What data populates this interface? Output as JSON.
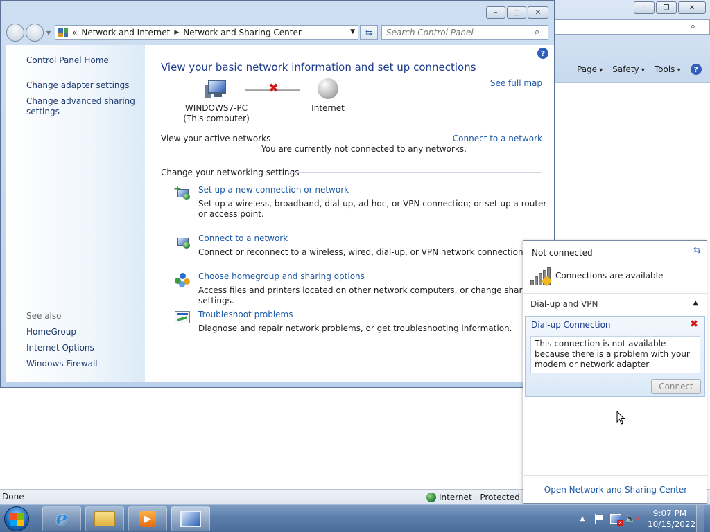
{
  "ie": {
    "command_bar": [
      "Page",
      "Safety",
      "Tools"
    ],
    "status": {
      "left": "Done",
      "zone": "Internet | Protected Mo"
    }
  },
  "control_panel": {
    "breadcrumb": [
      "Network and Internet",
      "Network and Sharing Center"
    ],
    "breadcrumb_prefix": "«",
    "search_placeholder": "Search Control Panel",
    "sidebar": {
      "links": [
        "Control Panel Home",
        "Change adapter settings",
        "Change advanced sharing settings"
      ],
      "see_also_label": "See also",
      "see_also": [
        "HomeGroup",
        "Internet Options",
        "Windows Firewall"
      ]
    },
    "main": {
      "title": "View your basic network information and set up connections",
      "see_full_map": "See full map",
      "map": {
        "computer_name": "WINDOWS7-PC",
        "computer_sub": "(This computer)",
        "internet": "Internet"
      },
      "active_networks": {
        "heading": "View your active networks",
        "action": "Connect to a network",
        "message": "You are currently not connected to any networks."
      },
      "settings_heading": "Change your networking settings",
      "tasks": [
        {
          "link": "Set up a new connection or network",
          "desc": "Set up a wireless, broadband, dial-up, ad hoc, or VPN connection; or set up a router or access point.",
          "icon": "new-connection-icon"
        },
        {
          "link": "Connect to a network",
          "desc": "Connect or reconnect to a wireless, wired, dial-up, or VPN network connection.",
          "icon": "connect-network-icon"
        },
        {
          "link": "Choose homegroup and sharing options",
          "desc": "Access files and printers located on other network computers, or change sharing settings.",
          "icon": "homegroup-icon"
        },
        {
          "link": "Troubleshoot problems",
          "desc": "Diagnose and repair network problems, or get troubleshooting information.",
          "icon": "troubleshoot-icon"
        }
      ]
    }
  },
  "flyout": {
    "status": "Not connected",
    "available": "Connections are available",
    "group": "Dial-up and VPN",
    "connection_name": "Dial-up Connection",
    "connection_message": "This connection is not available because there is a problem with your modem or network adapter",
    "connect_button": "Connect",
    "open_center": "Open Network and Sharing Center"
  },
  "taskbar": {
    "clock_time": "9:07 PM",
    "clock_date": "10/15/2022"
  },
  "colors": {
    "link": "#1e5aa8",
    "title": "#1e3c8c",
    "error_red": "#d21818"
  }
}
